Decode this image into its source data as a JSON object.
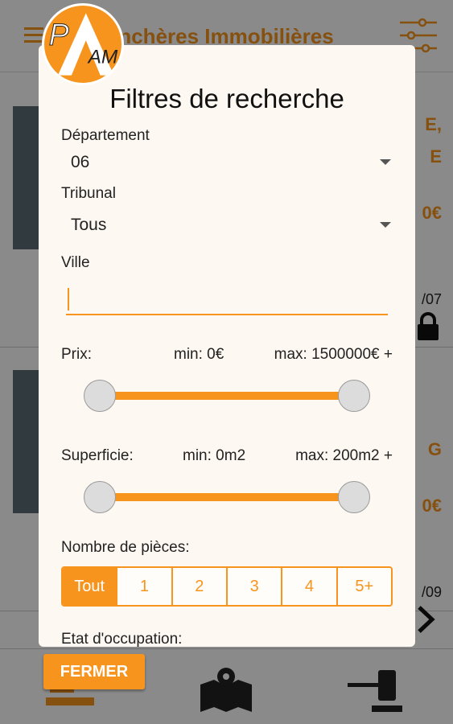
{
  "app": {
    "title": "Enchères Immobilières",
    "accent_color": "#F7941D"
  },
  "logo": {
    "text_p": "P",
    "text_a": "A",
    "text_am": "AM"
  },
  "background_cards": [
    {
      "line1": "E,",
      "line2": "E",
      "price": "0€",
      "date": "/07",
      "icon": "lock-icon"
    },
    {
      "line1": "G",
      "price": "0€",
      "date": "/09",
      "icon": "chevron-right-icon"
    }
  ],
  "dialog": {
    "title": "Filtres de recherche",
    "departement": {
      "label": "Département",
      "value": "06"
    },
    "tribunal": {
      "label": "Tribunal",
      "value": "Tous"
    },
    "ville": {
      "label": "Ville",
      "value": "",
      "placeholder": ""
    },
    "prix": {
      "label": "Prix:",
      "min_text": "min: 0€",
      "max_text": "max: 1500000€ +",
      "min_fraction": 0,
      "max_fraction": 1
    },
    "superficie": {
      "label": "Superficie:",
      "min_text": "min: 0m2",
      "max_text": "max: 200m2 +",
      "min_fraction": 0,
      "max_fraction": 1
    },
    "pieces": {
      "label": "Nombre de pièces:",
      "options": [
        "Tout",
        "1",
        "2",
        "3",
        "4",
        "5+"
      ],
      "selected": "Tout"
    },
    "occupation": {
      "label": "Etat d'occupation:"
    }
  },
  "close_button": {
    "label": "FERMER"
  },
  "bottom_nav": {
    "icons": [
      "gavel-flat-icon",
      "map-icon",
      "gavel-icon"
    ]
  }
}
